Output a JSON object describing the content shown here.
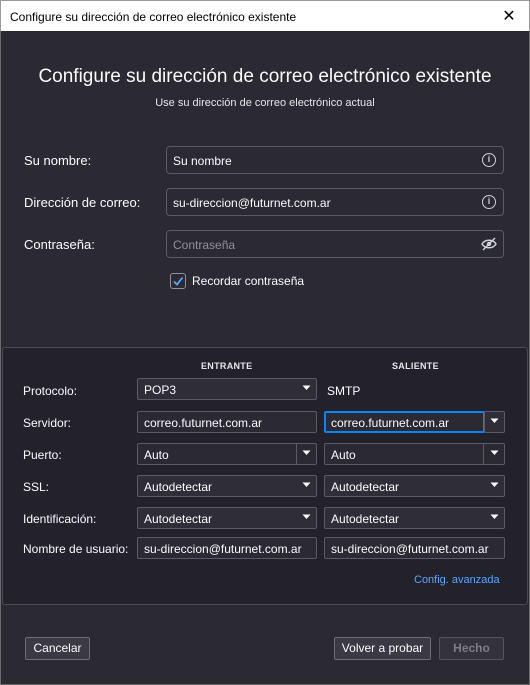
{
  "window": {
    "title": "Configure su dirección de correo electrónico existente",
    "close_glyph": "✕"
  },
  "header": {
    "title": "Configure su dirección de correo electrónico existente",
    "subtitle": "Use su dirección de correo electrónico actual"
  },
  "form": {
    "name_label": "Su nombre:",
    "name_value": "Su nombre",
    "email_label": "Dirección de correo:",
    "email_value": "su-direccion@futurnet.com.ar",
    "password_label": "Contraseña:",
    "password_placeholder": "Contraseña",
    "remember_label": "Recordar contraseña",
    "remember_checked": true
  },
  "server": {
    "incoming_header": "ENTRANTE",
    "outgoing_header": "SALIENTE",
    "protocol_label": "Protocolo:",
    "protocol_incoming": "POP3",
    "protocol_outgoing": "SMTP",
    "server_label": "Servidor:",
    "server_incoming": "correo.futurnet.com.ar",
    "server_outgoing": "correo.futurnet.com.ar",
    "port_label": "Puerto:",
    "port_incoming": "Auto",
    "port_outgoing": "Auto",
    "ssl_label": "SSL:",
    "ssl_incoming": "Autodetectar",
    "ssl_outgoing": "Autodetectar",
    "auth_label": "Identificación:",
    "auth_incoming": "Autodetectar",
    "auth_outgoing": "Autodetectar",
    "username_label": "Nombre de usuario:",
    "username_incoming": "su-direccion@futurnet.com.ar",
    "username_outgoing": "su-direccion@futurnet.com.ar",
    "advanced_link": "Config. avanzada"
  },
  "buttons": {
    "cancel": "Cancelar",
    "retest": "Volver a probar",
    "done": "Hecho"
  },
  "colors": {
    "background": "#2b2a33",
    "accent": "#0a84ff",
    "link": "#57a6ff"
  }
}
